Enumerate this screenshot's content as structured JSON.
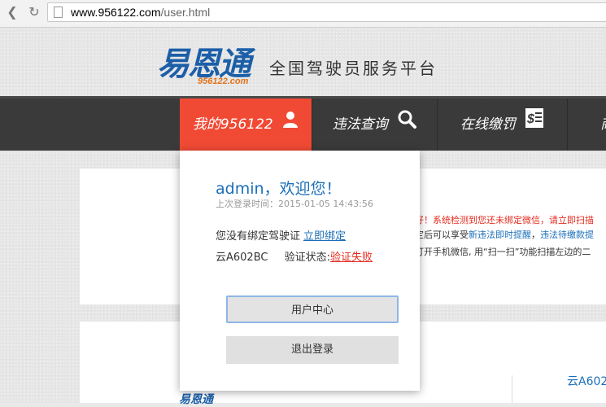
{
  "browser": {
    "url_host": "www.956122.com",
    "url_path": "/user.html"
  },
  "header": {
    "logo_text": "易恩通",
    "logo_domain": "956122.com",
    "slogan": "全国驾驶员服务平台"
  },
  "nav": {
    "items": [
      {
        "label": "我的956122",
        "icon": "user-icon",
        "active": true
      },
      {
        "label": "违法查询",
        "icon": "search-icon",
        "active": false
      },
      {
        "label": "在线缴罚",
        "icon": "bill-icon",
        "active": false
      },
      {
        "label": "商",
        "icon": "",
        "active": false
      }
    ]
  },
  "dropdown": {
    "welcome": "admin，欢迎您！",
    "last_login": "上次登录时间：2015-01-05 14:43:56",
    "no_license": "您没有绑定驾驶证",
    "bind_now": "立即绑定",
    "plate": "云A602BC",
    "verify_label": "验证状态:",
    "verify_status": "验证失败",
    "user_center": "用户中心",
    "logout": "退出登录"
  },
  "notice": {
    "line1": "好！系统检测到您还未绑定微信，请立即扫描",
    "line2_prefix": "定后可以享受",
    "line2_blue1": "新违法即时提醒",
    "line2_sep": "，",
    "line2_blue2": "违法待缴款提",
    "line3": "打开手机微信, 用“扫一扫”功能扫描左边的二"
  },
  "lower": {
    "plate": "云A602"
  },
  "colors": {
    "nav_active": "#f04a34",
    "nav_bg": "#3a3a3a",
    "link_blue": "#1b6fb8",
    "error_red": "#e32c1e"
  }
}
